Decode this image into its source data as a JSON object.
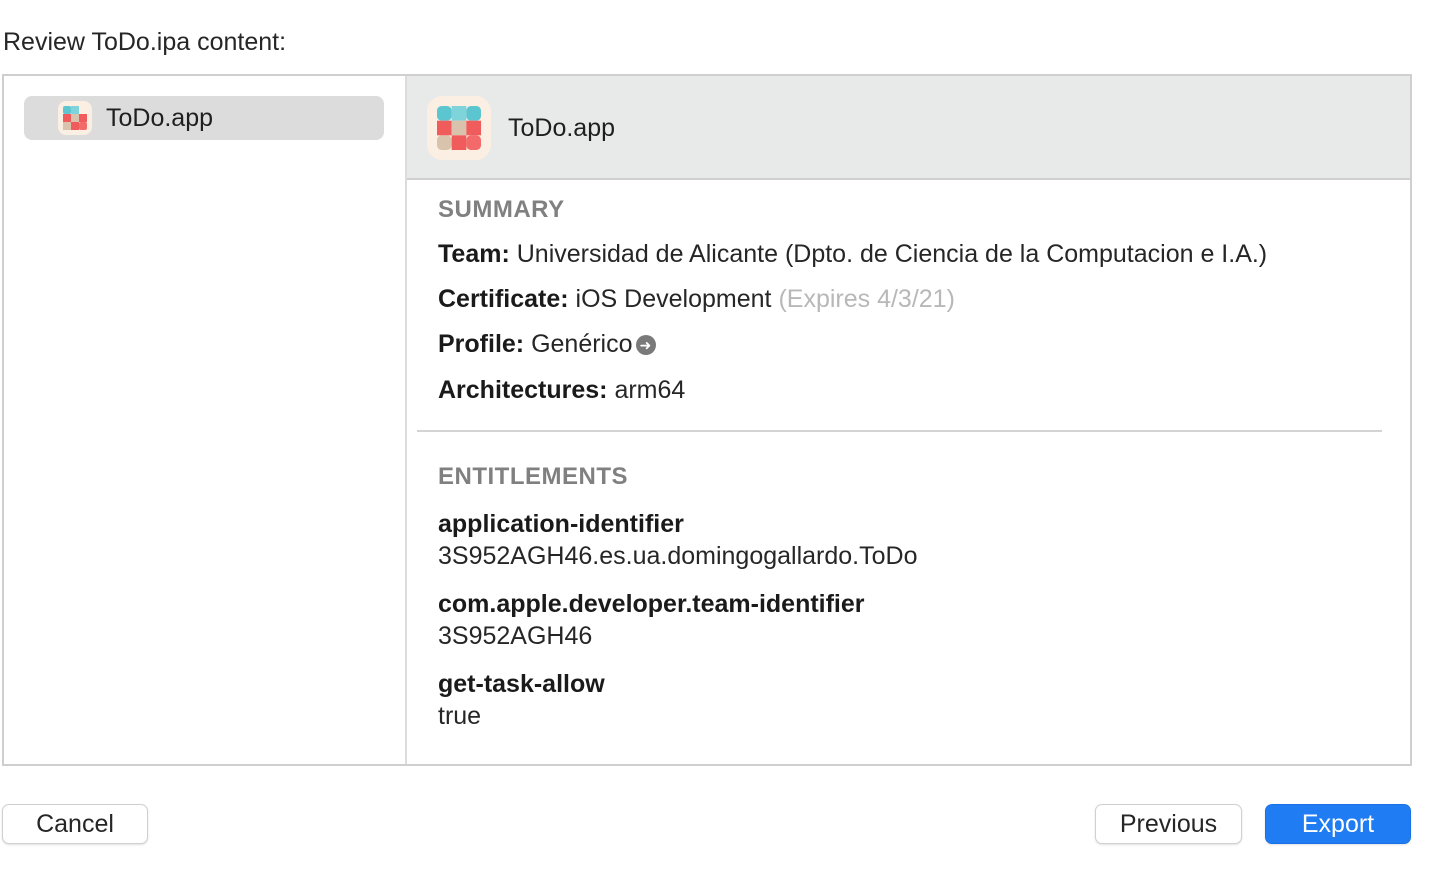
{
  "heading": "Review ToDo.ipa content:",
  "sidebar": {
    "items": [
      {
        "label": "ToDo.app",
        "icon": "todo-app-icon",
        "selected": true
      }
    ]
  },
  "detail": {
    "app_name": "ToDo.app",
    "summary": {
      "title": "SUMMARY",
      "team_label": "Team:",
      "team_value": "Universidad de Alicante (Dpto. de Ciencia de la Computacion e I.A.)",
      "certificate_label": "Certificate:",
      "certificate_value": "iOS Development",
      "certificate_expiry": "(Expires 4/3/21)",
      "profile_label": "Profile:",
      "profile_value": "Genérico",
      "architectures_label": "Architectures:",
      "architectures_value": "arm64"
    },
    "entitlements": {
      "title": "ENTITLEMENTS",
      "items": [
        {
          "key": "application-identifier",
          "value": "3S952AGH46.es.ua.domingogallardo.ToDo"
        },
        {
          "key": "com.apple.developer.team-identifier",
          "value": "3S952AGH46"
        },
        {
          "key": "get-task-allow",
          "value": "true"
        }
      ]
    }
  },
  "buttons": {
    "cancel": "Cancel",
    "previous": "Previous",
    "export": "Export"
  },
  "colors": {
    "accent": "#1f7cf3",
    "header_bg": "#e8e9e9",
    "selection_bg": "#dcdcdc",
    "icon_teal": "#5cc6d0",
    "icon_red": "#f05c5c",
    "icon_beige": "#d9c3ad"
  }
}
